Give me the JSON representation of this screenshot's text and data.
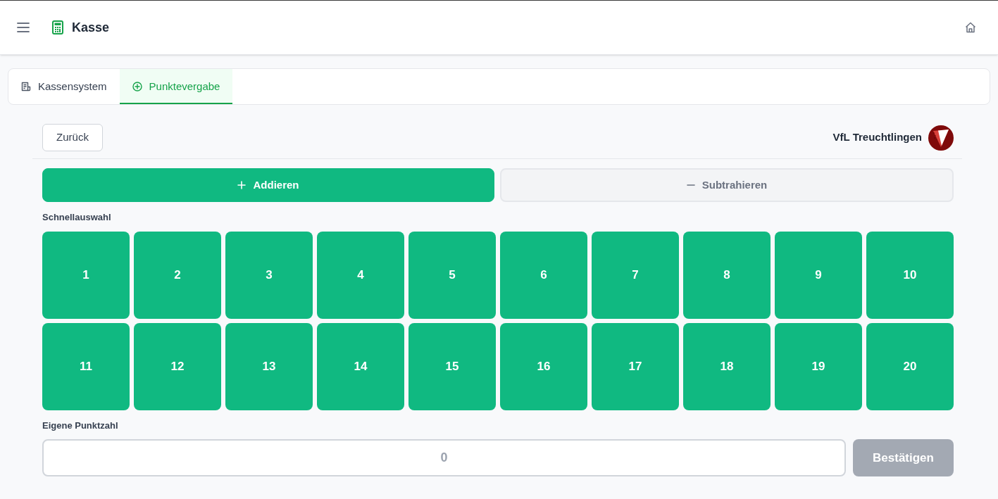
{
  "header": {
    "title": "Kasse"
  },
  "tabs": [
    {
      "label": "Kassensystem",
      "selected": false
    },
    {
      "label": "Punktevergabe",
      "selected": true
    }
  ],
  "toolbar": {
    "back_button": "Zurück",
    "club_name": "VfL Treuchtlingen"
  },
  "mode_buttons": [
    {
      "label": "Addieren",
      "kind": "add",
      "selected": true
    },
    {
      "label": "Subtrahieren",
      "kind": "subtract",
      "selected": false
    }
  ],
  "quick_select": {
    "label": "Schnellauswahl",
    "values": [
      "1",
      "2",
      "3",
      "4",
      "5",
      "6",
      "7",
      "8",
      "9",
      "10",
      "11",
      "12",
      "13",
      "14",
      "15",
      "16",
      "17",
      "18",
      "19",
      "20"
    ]
  },
  "custom_points": {
    "label": "Eigene Punktzahl",
    "placeholder": "0",
    "confirm_button": {
      "label": "Bestätigen",
      "disabled": true
    }
  }
}
